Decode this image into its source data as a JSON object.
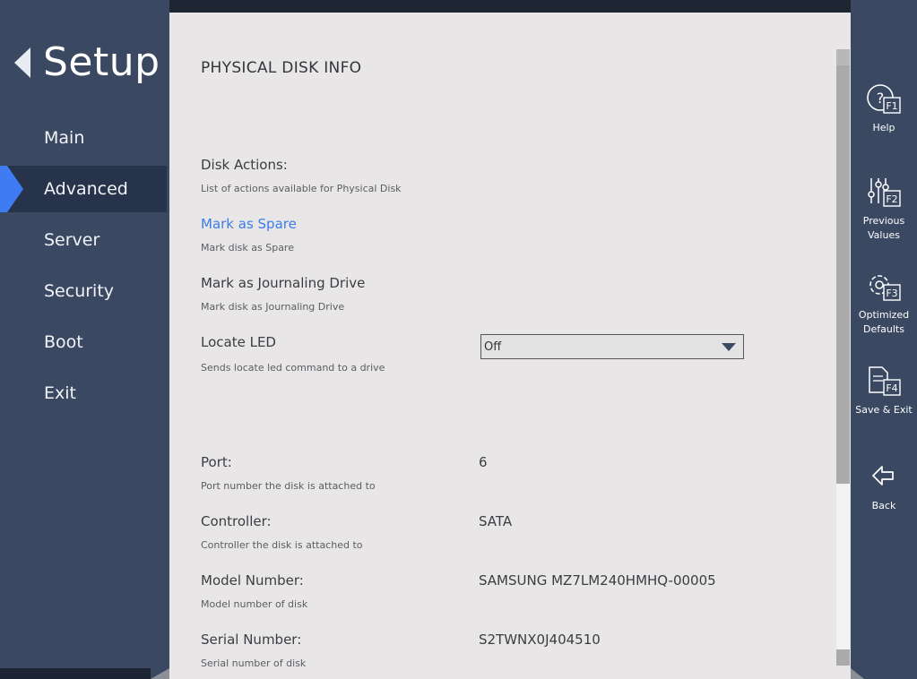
{
  "sidebar": {
    "title": "Setup",
    "items": [
      {
        "label": "Main"
      },
      {
        "label": "Advanced",
        "active": true
      },
      {
        "label": "Server"
      },
      {
        "label": "Security"
      },
      {
        "label": "Boot"
      },
      {
        "label": "Exit"
      }
    ]
  },
  "page": {
    "title": "PHYSICAL DISK INFO",
    "disk_actions": {
      "label": "Disk Actions:",
      "desc": "List of actions available for Physical Disk"
    },
    "mark_spare": {
      "label": "Mark as Spare",
      "desc": "Mark disk as Spare"
    },
    "mark_journal": {
      "label": "Mark as Journaling Drive",
      "desc": "Mark disk as Journaling Drive"
    },
    "locate_led": {
      "label": "Locate LED",
      "desc": "Sends locate led command to a drive",
      "value": "Off"
    },
    "port": {
      "label": "Port:",
      "desc": "Port number the disk is attached to",
      "value": "6"
    },
    "controller": {
      "label": "Controller:",
      "desc": "Controller the disk is attached to",
      "value": "SATA"
    },
    "model": {
      "label": "Model Number:",
      "desc": "Model number of disk",
      "value": "SAMSUNG MZ7LM240HMHQ-00005"
    },
    "serial": {
      "label": "Serial Number:",
      "desc": "Serial number of disk",
      "value": "S2TWNX0J404510"
    }
  },
  "function_keys": [
    {
      "key": "F1",
      "label": "Help",
      "icon": "help-icon"
    },
    {
      "key": "F2",
      "label": "Previous Values",
      "icon": "sliders-icon"
    },
    {
      "key": "F3",
      "label": "Optimized Defaults",
      "icon": "gear-icon"
    },
    {
      "key": "F4",
      "label": "Save & Exit",
      "icon": "document-icon"
    },
    {
      "key": "",
      "label": "Back",
      "icon": "back-arrow-icon"
    }
  ],
  "colors": {
    "accent": "#3f7bf2",
    "sidebar": "#3a4861",
    "link": "#3b7ee8"
  }
}
